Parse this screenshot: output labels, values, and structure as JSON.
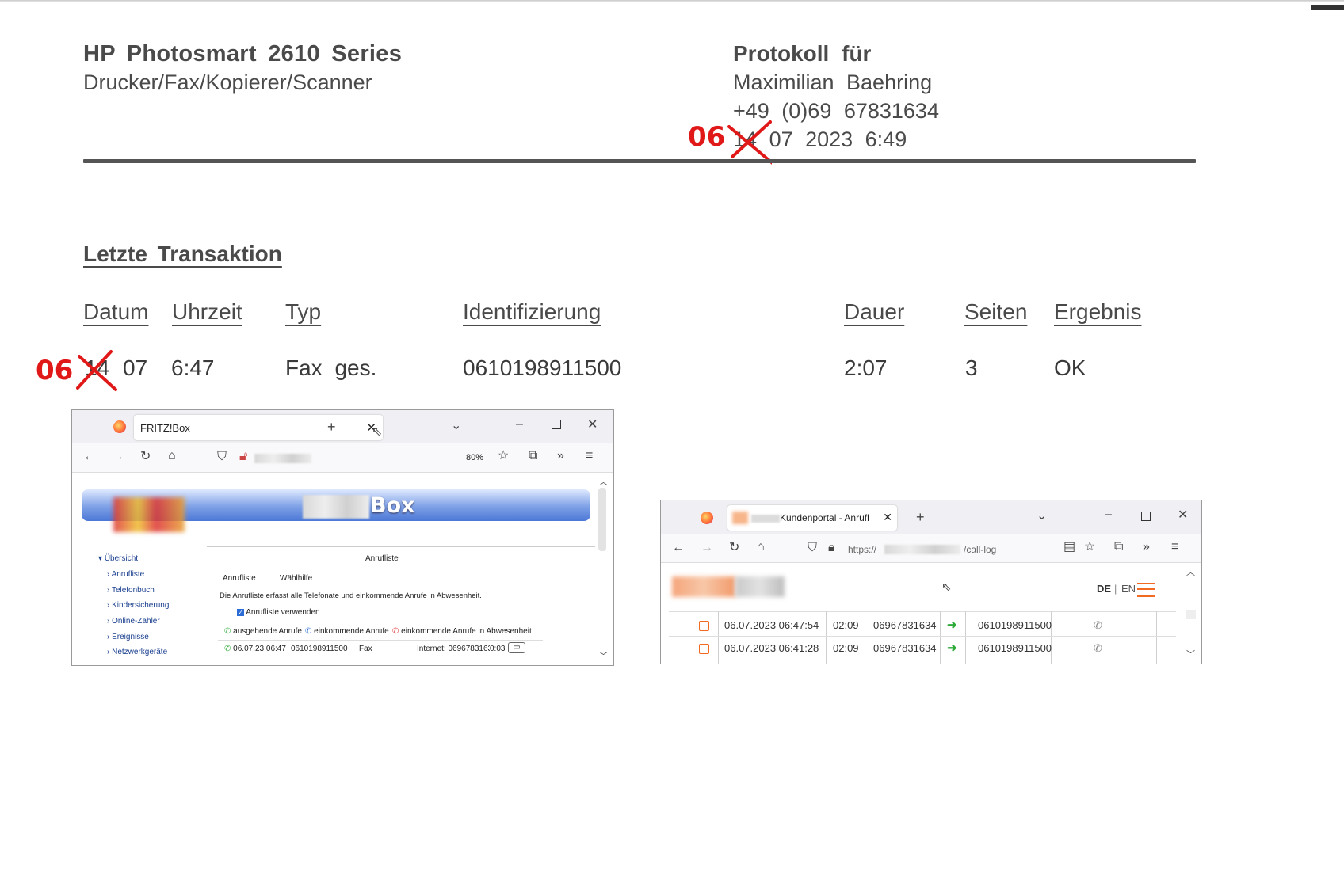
{
  "header": {
    "title": "HP Photosmart 2610 Series",
    "subtitle": "Drucker/Fax/Kopierer/Scanner",
    "protocol_label": "Protokoll für",
    "name": "Maximilian Baehring",
    "phone": "+49 (0)69 67831634",
    "date_struck_day": "14",
    "date_rest": "07 2023 6:49",
    "date_correction": "06"
  },
  "transaction": {
    "section_title": "Letzte Transaktion",
    "columns": [
      "Datum",
      "Uhrzeit",
      "Typ",
      "Identifizierung",
      "Dauer",
      "Seiten",
      "Ergebnis"
    ],
    "row": {
      "date_struck_day": "14",
      "date_month": "07",
      "correction": "06",
      "time": "6:47",
      "type": "Fax ges.",
      "id": "0610198911500",
      "duration": "2:07",
      "pages": "3",
      "result": "OK"
    }
  },
  "fritz_window": {
    "tab_title": "FRITZ!Box",
    "zoom": "80%",
    "banner_text": "Box",
    "sidebar": [
      "Übersicht",
      "Anrufliste",
      "Telefonbuch",
      "Kindersicherung",
      "Online-Zähler",
      "Ereignisse",
      "Netzwerkgeräte"
    ],
    "panel_title": "Anrufliste",
    "tabs": [
      "Anrufliste",
      "Wählhilfe"
    ],
    "description": "Die Anrufliste erfasst alle Telefonate und einkommende Anrufe in Abwesenheit.",
    "checkbox_label": "Anrufliste verwenden",
    "legend": [
      "ausgehende Anrufe",
      "einkommende Anrufe",
      "einkommende Anrufe in Abwesenheit"
    ],
    "entry": {
      "datetime": "06.07.23 06:47",
      "number": "0610198911500",
      "type": "Fax",
      "line": "Internet: 0696783163",
      "duration": "0:03"
    }
  },
  "portal_window": {
    "tab_title": "Kundenportal - Anrufl",
    "url_prefix": "https://",
    "url_suffix": "/call-log",
    "lang_de": "DE",
    "lang_sep": "|",
    "lang_en": "EN",
    "rows": [
      {
        "datetime": "06.07.2023 06:47:54",
        "duration": "02:09",
        "from": "06967831634",
        "to": "0610198911500"
      },
      {
        "datetime": "06.07.2023 06:41:28",
        "duration": "02:09",
        "from": "06967831634",
        "to": "0610198911500"
      }
    ]
  },
  "colors": {
    "correction_red": "#e01818",
    "firefox_orange": "#ff7139",
    "portal_orange": "#f26a21",
    "arrow_green": "#2eaa3a",
    "fritz_blue": "#4c78d6"
  }
}
